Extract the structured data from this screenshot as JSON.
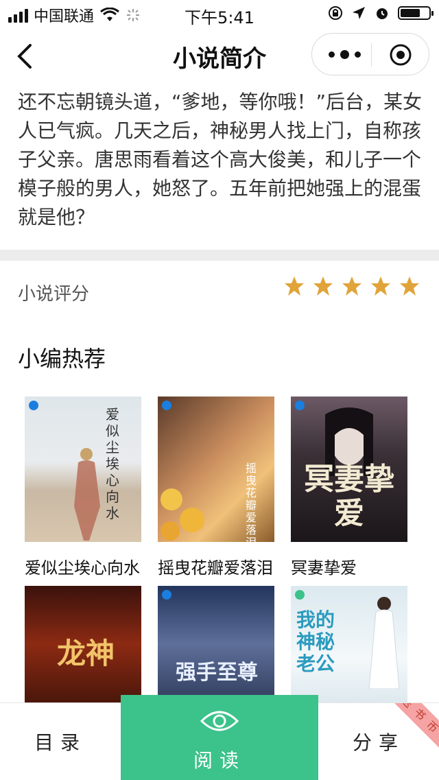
{
  "status_bar": {
    "carrier": "中国联通",
    "time": "下午5:41"
  },
  "nav": {
    "title": "小说简介"
  },
  "intro": {
    "text": "还不忘朝镜头道，“爹地，等你哦！”后台，某女人已气疯。几天之后，神秘男人找上门，自称孩子父亲。唐思雨看着这个高大俊美，和儿子一个模子般的男人，她怒了。五年前把她强上的混蛋就是他？"
  },
  "rating": {
    "label": "小说评分",
    "stars": 5,
    "star_color": "#e0a43a"
  },
  "recommend": {
    "title": "小编热荐",
    "books": [
      {
        "title": "爱似尘埃心向水",
        "cover_text": "爱似尘埃心向水"
      },
      {
        "title": "摇曳花瓣爱落泪",
        "cover_text": "摇曳花瓣爱落泪"
      },
      {
        "title": "冥妻挚爱",
        "cover_text": "冥妻挚爱"
      },
      {
        "title": "",
        "cover_text": "龙神"
      },
      {
        "title": "",
        "cover_text": "强手至尊"
      },
      {
        "title": "",
        "cover_text": "我的神秘老公"
      }
    ]
  },
  "bottom_bar": {
    "catalog": "目录",
    "read": "阅读",
    "share": "分享",
    "ribbon": "送书币",
    "accent": "#3cc28b"
  }
}
